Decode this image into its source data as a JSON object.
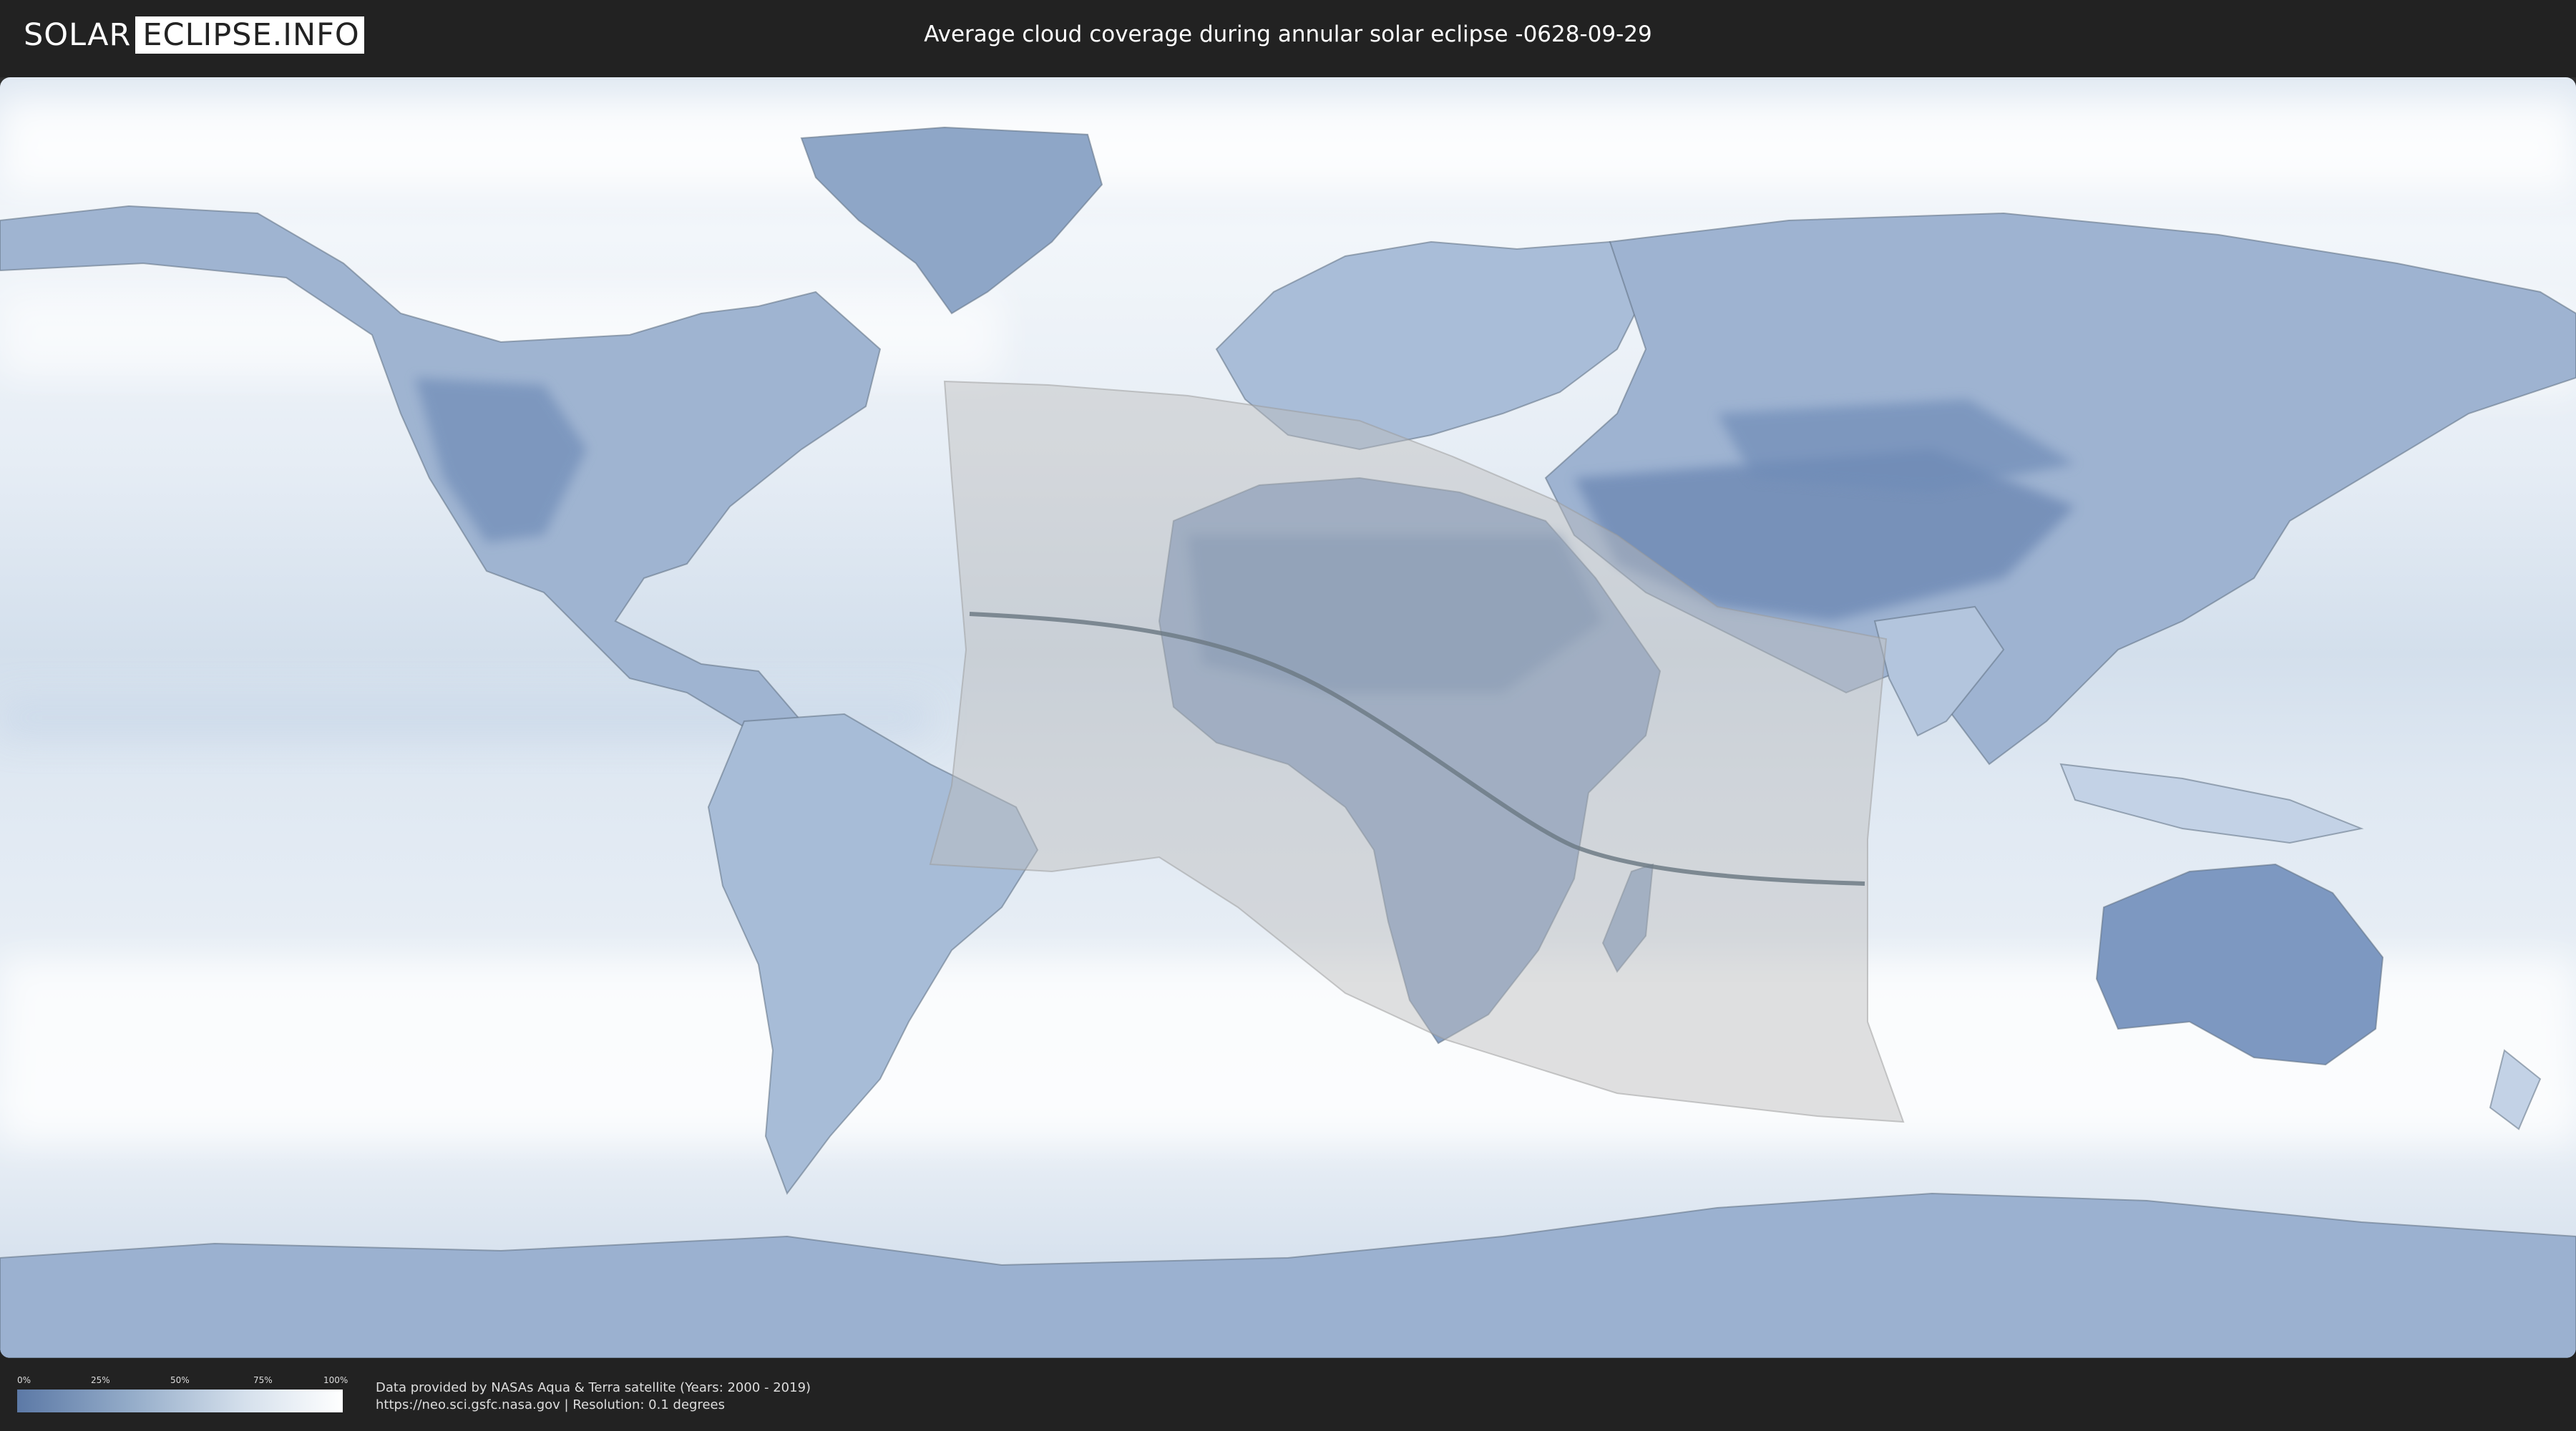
{
  "header": {
    "logo_left": "SOLAR",
    "logo_right": "ECLIPSE.INFO",
    "title": "Average cloud coverage during annular solar eclipse -0628-09-29"
  },
  "legend": {
    "ticks": [
      "0%",
      "25%",
      "50%",
      "75%",
      "100%"
    ],
    "colors": {
      "low": "#5c79a6",
      "high": "#ffffff"
    }
  },
  "footer": {
    "credit_line1": "Data provided by NASAs Aqua & Terra satellite (Years: 2000 - 2019)",
    "credit_line2": "https://neo.sci.gsfc.nasa.gov | Resolution: 0.1 degrees"
  },
  "map": {
    "colors": {
      "ocean": "#e8eef5",
      "land_clear": "#6f8cb7",
      "cloud": "#ffffff",
      "eclipse_zone": "#b9b9b9",
      "central_line": "#6f7b86"
    }
  }
}
